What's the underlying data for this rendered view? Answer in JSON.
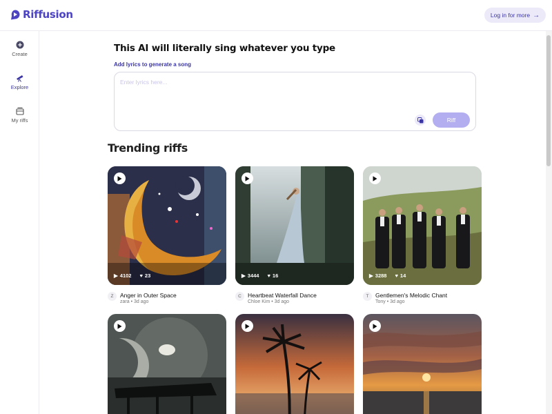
{
  "app": {
    "name": "Riffusion",
    "accent": "#4d44c3"
  },
  "header": {
    "login_label": "Log in for more",
    "login_icon": "arrow-right-icon"
  },
  "sidebar": {
    "items": [
      {
        "label": "Create",
        "icon": "plus-circle-icon"
      },
      {
        "label": "Explore",
        "icon": "telescope-icon"
      },
      {
        "label": "My riffs",
        "icon": "library-icon"
      }
    ]
  },
  "main": {
    "headline": "This AI will literally sing whatever you type",
    "lyrics_label": "Add lyrics to generate a song",
    "lyrics_placeholder": "Enter lyrics here...",
    "riff_label": "Riff",
    "trending_title": "Trending riffs"
  },
  "riffs": [
    {
      "title": "Anger in Outer Space",
      "author": "zara",
      "age": "3d ago",
      "avatar": "Z",
      "plays": "4102",
      "likes": "23"
    },
    {
      "title": "Heartbeat Waterfall Dance",
      "author": "Chloe Kim",
      "age": "3d ago",
      "avatar": "C",
      "plays": "3444",
      "likes": "16"
    },
    {
      "title": "Gentlemen's Melodic Chant",
      "author": "Tony",
      "age": "3d ago",
      "avatar": "T",
      "plays": "3288",
      "likes": "14"
    },
    {
      "title": "",
      "author": "",
      "age": "",
      "avatar": "",
      "plays": "",
      "likes": ""
    },
    {
      "title": "",
      "author": "",
      "age": "",
      "avatar": "",
      "plays": "",
      "likes": ""
    },
    {
      "title": "",
      "author": "",
      "age": "",
      "avatar": "",
      "plays": "",
      "likes": ""
    }
  ],
  "byline_separator": "•"
}
